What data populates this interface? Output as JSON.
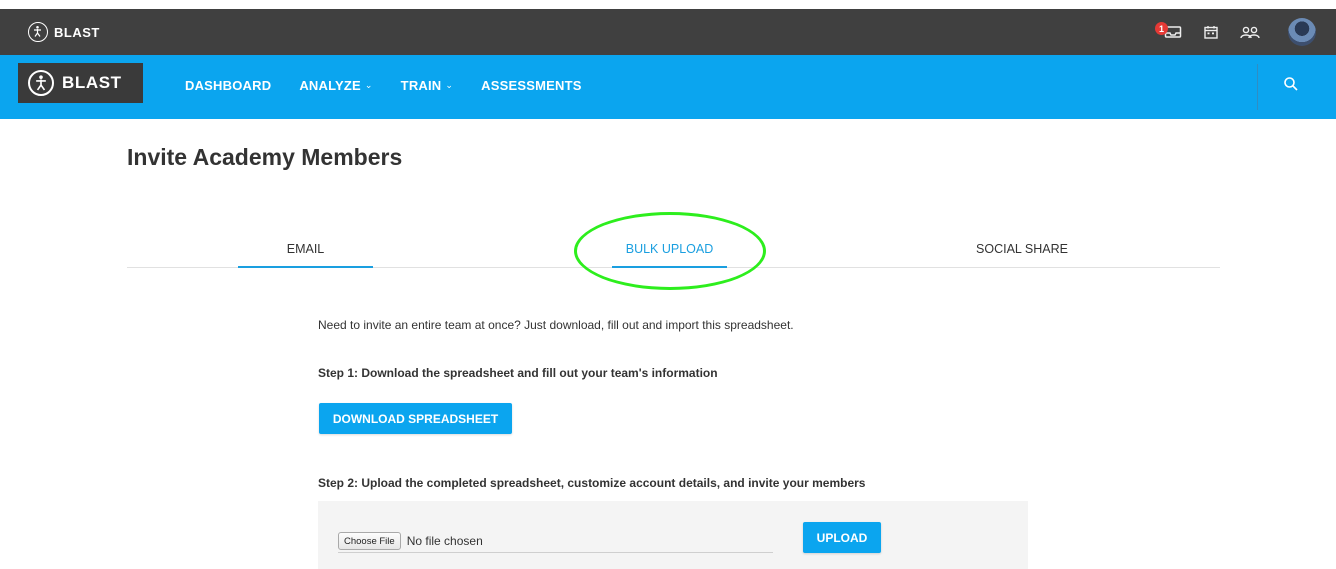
{
  "topbar": {
    "brand": "BLAST",
    "notification_count": "1",
    "icons": [
      "inbox-icon",
      "calendar-icon",
      "team-icon",
      "avatar"
    ]
  },
  "navbar": {
    "logo": "BLAST",
    "links": [
      {
        "label": "DASHBOARD",
        "dropdown": false
      },
      {
        "label": "ANALYZE",
        "dropdown": true
      },
      {
        "label": "TRAIN",
        "dropdown": true
      },
      {
        "label": "ASSESSMENTS",
        "dropdown": false
      }
    ]
  },
  "page": {
    "title": "Invite Academy Members"
  },
  "tabs": [
    {
      "label": "EMAIL"
    },
    {
      "label": "BULK UPLOAD"
    },
    {
      "label": "SOCIAL SHARE"
    }
  ],
  "bulk_upload": {
    "intro": "Need to invite an entire team at once? Just download, fill out and import this spreadsheet.",
    "step1": "Step 1: Download the spreadsheet and fill out your team's information",
    "download_label": "DOWNLOAD SPREADSHEET",
    "step2": "Step 2: Upload the completed spreadsheet, customize account details, and invite your members",
    "choose_file_label": "Choose File",
    "file_status": "No file chosen",
    "upload_label": "UPLOAD"
  },
  "colors": {
    "accent": "#0ba5ef",
    "topbar": "#404040",
    "highlight": "#2dee1d",
    "badge": "#e53935"
  }
}
